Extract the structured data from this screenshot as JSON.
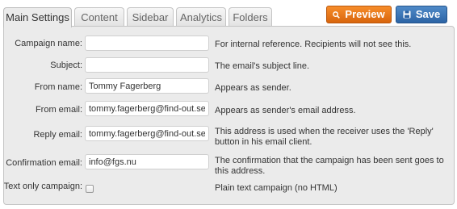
{
  "tabs": [
    {
      "label": "Main Settings",
      "active": true
    },
    {
      "label": "Content",
      "active": false
    },
    {
      "label": "Sidebar",
      "active": false
    },
    {
      "label": "Analytics",
      "active": false
    },
    {
      "label": "Folders",
      "active": false
    }
  ],
  "toolbar": {
    "preview_label": "Preview",
    "preview_icon": "search-icon",
    "preview_color": "#ee7a1c",
    "save_label": "Save",
    "save_icon": "floppy-disk-icon",
    "save_color": "#3a73b4"
  },
  "form": {
    "campaign_name": {
      "label": "Campaign name:",
      "value": "",
      "help": "For internal reference. Recipients will not see this."
    },
    "subject": {
      "label": "Subject:",
      "value": "",
      "help": "The email's subject line."
    },
    "from_name": {
      "label": "From name:",
      "value": "Tommy Fagerberg",
      "help": "Appears as sender."
    },
    "from_email": {
      "label": "From email:",
      "value": "tommy.fagerberg@find-out.se",
      "help": "Appears as sender's email address."
    },
    "reply_email": {
      "label": "Reply email:",
      "value": "tommy.fagerberg@find-out.se",
      "help": "This address is used when the receiver uses the 'Reply' button in his email client."
    },
    "confirmation_email": {
      "label": "Confirmation email:",
      "value": "info@fgs.nu",
      "help": "The confirmation that the campaign has been sent goes to this address."
    },
    "text_only": {
      "label": "Text only campaign:",
      "checked": false,
      "help": "Plain text campaign (no HTML)"
    }
  }
}
